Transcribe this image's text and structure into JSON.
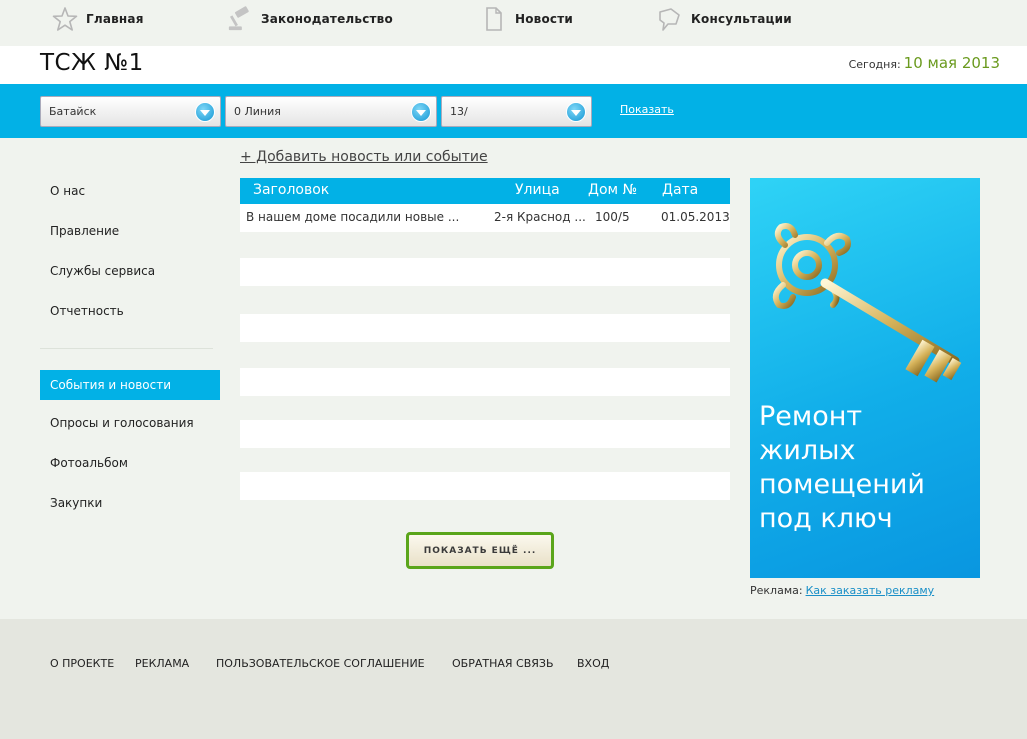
{
  "nav": {
    "home": "Главная",
    "law": "Законодательство",
    "news": "Новости",
    "consult": "Консультации"
  },
  "header": {
    "title": "ТСЖ №1",
    "today_label": "Сегодня:",
    "today_date": "10 мая 2013"
  },
  "filters": {
    "city": "Батайск",
    "street": "0 Линия",
    "house": "13/",
    "show": "Показать"
  },
  "sidebar": {
    "items": [
      "О нас",
      "Правление",
      "Службы сервиса",
      "Отчетность",
      "События и новости",
      "Опросы и голосования",
      "Фотоальбом",
      "Закупки"
    ],
    "active_index": 4
  },
  "main": {
    "add_link": "+ Добавить новость или событие",
    "columns": [
      "Заголовок",
      "Улица",
      "Дом №",
      "Дата"
    ],
    "rows": [
      {
        "title": "В нашем доме посадили новые ...",
        "street": "2-я Краснод ...",
        "house": "100/5",
        "date": "01.05.2013"
      }
    ],
    "more_button": "ПОКАЗАТЬ ЕЩЁ ..."
  },
  "ad": {
    "line1": "Ремонт",
    "line2": "жилых",
    "line3": "помещений",
    "line4": "под ключ",
    "caption_label": "Реклама:",
    "caption_link": "Как заказать рекламу"
  },
  "footer": {
    "links": [
      "О ПРОЕКТЕ",
      "РЕКЛАМА",
      "ПОЛЬЗОВАТЕЛЬСКОЕ СОГЛАШЕНИЕ",
      "ОБРАТНАЯ СВЯЗЬ",
      "ВХОД"
    ]
  },
  "colors": {
    "accent": "#02b1e6",
    "date_green": "#6a9a1e",
    "button_border": "#5aa51a"
  }
}
